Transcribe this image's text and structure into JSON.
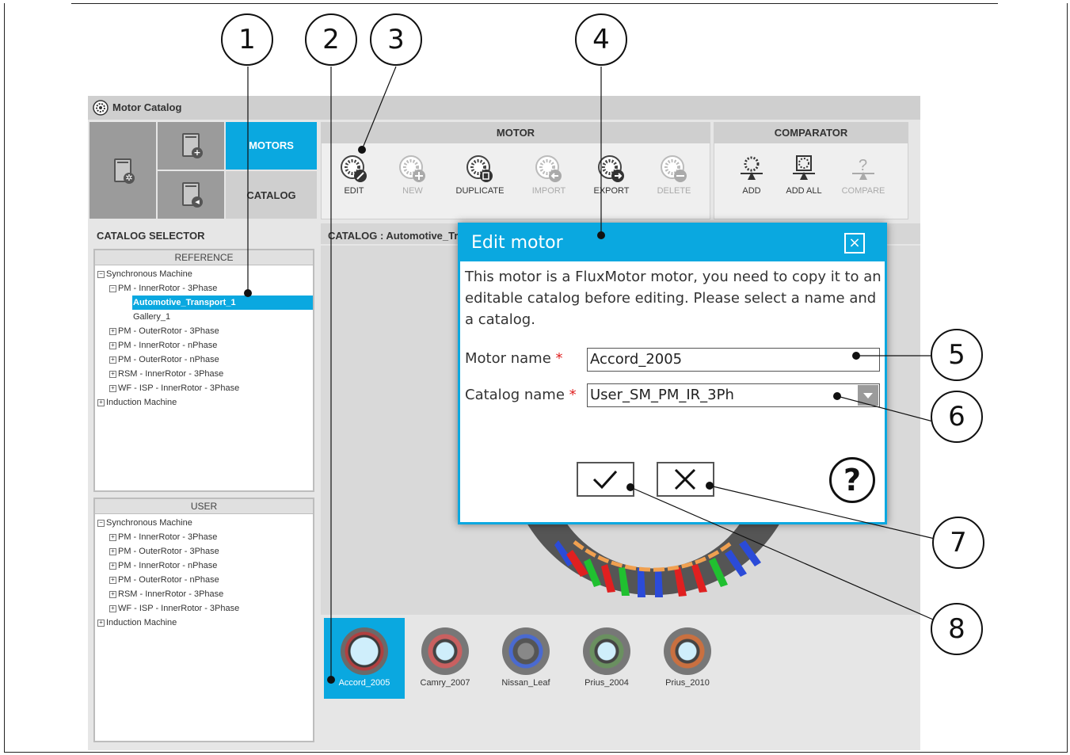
{
  "window": {
    "title": "Motor Catalog"
  },
  "nav": {
    "motors_label": "MOTORS",
    "catalog_label": "CATALOG"
  },
  "motor_group": {
    "title": "MOTOR",
    "buttons": [
      {
        "label": "EDIT",
        "enabled": true
      },
      {
        "label": "NEW",
        "enabled": false
      },
      {
        "label": "DUPLICATE",
        "enabled": true
      },
      {
        "label": "IMPORT",
        "enabled": false
      },
      {
        "label": "EXPORT",
        "enabled": true
      },
      {
        "label": "DELETE",
        "enabled": false
      }
    ]
  },
  "comparator_group": {
    "title": "COMPARATOR",
    "buttons": [
      {
        "label": "ADD",
        "enabled": true
      },
      {
        "label": "ADD ALL",
        "enabled": true
      },
      {
        "label": "COMPARE",
        "enabled": false
      }
    ]
  },
  "catalog_selector": {
    "title": "CATALOG SELECTOR",
    "reference": {
      "header": "REFERENCE",
      "nodes": [
        "Synchronous Machine",
        "PM - InnerRotor - 3Phase",
        "Automotive_Transport_1",
        "Gallery_1",
        "PM - OuterRotor - 3Phase",
        "PM - InnerRotor - nPhase",
        "PM - OuterRotor - nPhase",
        "RSM - InnerRotor - 3Phase",
        "WF - ISP - InnerRotor - 3Phase",
        "Induction Machine"
      ]
    },
    "user": {
      "header": "USER",
      "nodes": [
        "Synchronous Machine",
        "PM - InnerRotor - 3Phase",
        "PM - OuterRotor - 3Phase",
        "PM - InnerRotor - nPhase",
        "PM - OuterRotor - nPhase",
        "RSM - InnerRotor - 3Phase",
        "WF - ISP - InnerRotor - 3Phase",
        "Induction Machine"
      ]
    }
  },
  "catalog_view": {
    "header": "CATALOG : Automotive_Tr",
    "motors": [
      "Accord_2005",
      "Camry_2007",
      "Nissan_Leaf",
      "Prius_2004",
      "Prius_2010"
    ],
    "selected": "Accord_2005"
  },
  "dialog": {
    "title": "Edit motor",
    "close_glyph": "×",
    "message": "This motor is a FluxMotor motor, you need to copy it to an editable catalog before editing. Please select a name and a catalog.",
    "motor_name_label": "Motor name",
    "motor_name_value": "Accord_2005",
    "catalog_name_label": "Catalog name",
    "catalog_name_value": "User_SM_PM_IR_3Ph",
    "required_mark": "*",
    "help_glyph": "?"
  },
  "callouts": [
    "1",
    "2",
    "3",
    "4",
    "5",
    "6",
    "7",
    "8"
  ],
  "colors": {
    "accent": "#0aa8e0",
    "required": "#e02020",
    "panel": "#e6e6e6"
  }
}
